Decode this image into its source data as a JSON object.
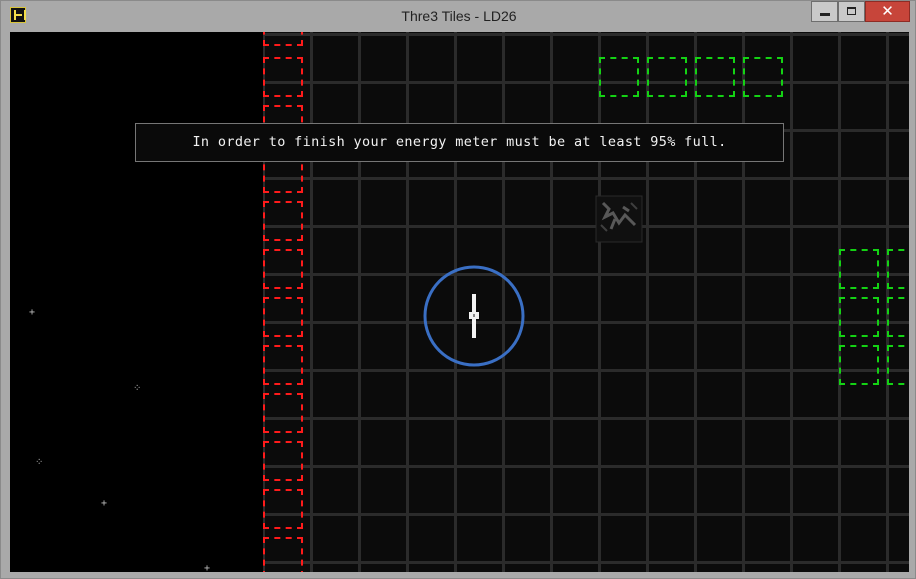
{
  "window": {
    "title": "Thre3 Tiles - LD26",
    "icon": "game-app-icon",
    "controls": {
      "minimize": "minimize-icon",
      "maximize": "maximize-icon",
      "close": "close-icon",
      "close_glyph": "✕"
    }
  },
  "game": {
    "message": "In order to finish your energy meter must be at least 95% full.",
    "colors": {
      "red_tile": "#ff1b1b",
      "green_tile": "#14d214",
      "player_ring": "#3a6fc4",
      "grid_line": "#2b2b2b",
      "background": "#050505"
    },
    "tiles": {
      "red_count": 12,
      "green_count": 10
    },
    "player": {
      "icon": "player-ship-icon"
    }
  }
}
